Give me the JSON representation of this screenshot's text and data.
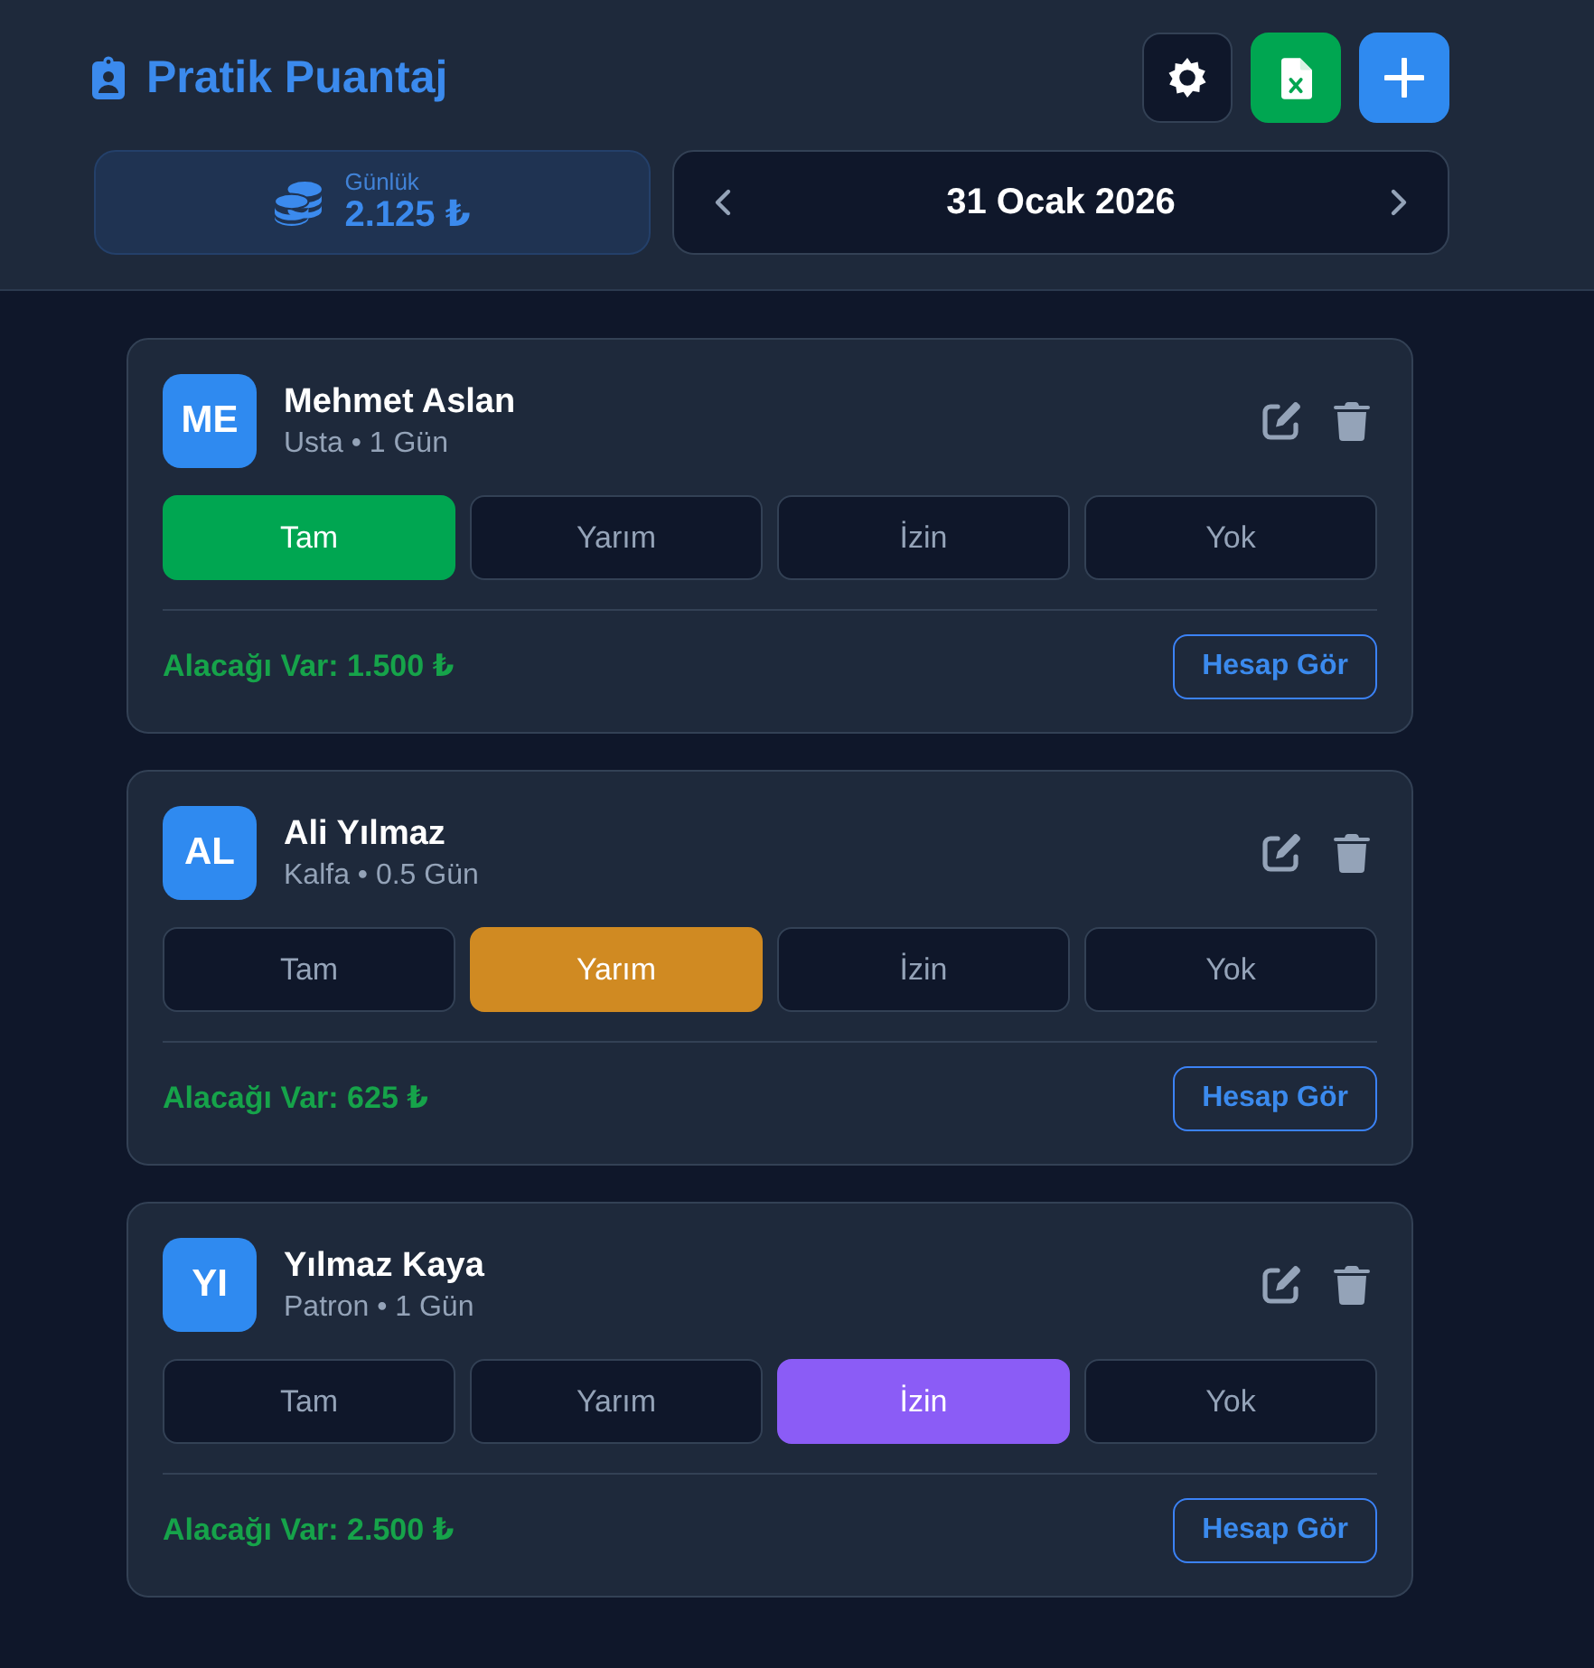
{
  "header": {
    "title": "Pratik Puantaj",
    "daily": {
      "label": "Günlük",
      "value": "2.125 ₺"
    },
    "date": "31 Ocak 2026"
  },
  "workers": [
    {
      "initials": "ME",
      "name": "Mehmet Aslan",
      "meta": "Usta • 1 Gün",
      "options": [
        {
          "label": "Tam",
          "selected": true
        },
        {
          "label": "Yarım",
          "selected": false
        },
        {
          "label": "İzin",
          "selected": false
        },
        {
          "label": "Yok",
          "selected": false
        }
      ],
      "balance": "Alacağı Var: 1.500 ₺",
      "account_button": "Hesap Gör"
    },
    {
      "initials": "AL",
      "name": "Ali Yılmaz",
      "meta": "Kalfa • 0.5 Gün",
      "options": [
        {
          "label": "Tam",
          "selected": false
        },
        {
          "label": "Yarım",
          "selected": true
        },
        {
          "label": "İzin",
          "selected": false
        },
        {
          "label": "Yok",
          "selected": false
        }
      ],
      "balance": "Alacağı Var: 625 ₺",
      "account_button": "Hesap Gör"
    },
    {
      "initials": "YI",
      "name": "Yılmaz Kaya",
      "meta": "Patron • 1 Gün",
      "options": [
        {
          "label": "Tam",
          "selected": false
        },
        {
          "label": "Yarım",
          "selected": false
        },
        {
          "label": "İzin",
          "selected": true
        },
        {
          "label": "Yok",
          "selected": false
        }
      ],
      "balance": "Alacağı Var: 2.500 ₺",
      "account_button": "Hesap Gör"
    }
  ]
}
